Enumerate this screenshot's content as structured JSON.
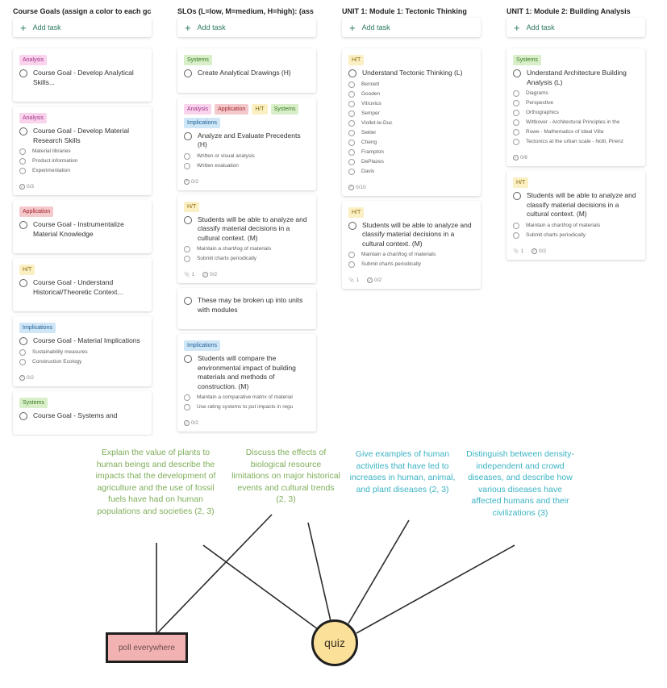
{
  "tag_colors": {
    "Analysis": {
      "bg": "#f9d4ec",
      "fg": "#a2338a"
    },
    "Application": {
      "bg": "#f4c9cc",
      "fg": "#a4262c"
    },
    "H/T": {
      "bg": "#fbefc4",
      "fg": "#8a6d0b"
    },
    "Systems": {
      "bg": "#d8efc9",
      "fg": "#3b7a1f"
    },
    "Implications": {
      "bg": "#cfe6f7",
      "fg": "#1b5e95"
    }
  },
  "board": {
    "add_task_label": "Add task",
    "columns": [
      {
        "title": "Course Goals (assign a color to each gc",
        "cards": [
          {
            "tags": [
              "Analysis"
            ],
            "title": "Course Goal - Develop Analytical Skills...",
            "subtasks": [],
            "footer": {}
          },
          {
            "tags": [
              "Analysis"
            ],
            "title": "Course Goal - Develop Material Research Skills",
            "subtasks": [
              "Material libraries",
              "Product information",
              "Experimentation"
            ],
            "footer": {
              "checklist": "0/3"
            }
          },
          {
            "tags": [
              "Application"
            ],
            "title": "Course Goal - Instrumentalize Material Knowledge",
            "subtasks": [],
            "footer": {}
          },
          {
            "tags": [
              "H/T"
            ],
            "title": "Course Goal - Understand Historical/Theoretic Context...",
            "subtasks": [],
            "footer": {}
          },
          {
            "tags": [
              "Implications"
            ],
            "title": "Course Goal - Material Implications",
            "subtasks": [
              "Sustainability measures",
              "Construction Ecology"
            ],
            "footer": {
              "checklist": "0/2"
            }
          },
          {
            "tags": [
              "Systems"
            ],
            "title": "Course Goal - Systems and",
            "subtasks": [],
            "footer": {}
          }
        ]
      },
      {
        "title": "SLOs (L=low, M=medium, H=high): (ass",
        "cards": [
          {
            "tags": [
              "Systems"
            ],
            "title": "Create Analytical Drawings (H)",
            "subtasks": [],
            "footer": {}
          },
          {
            "tags": [
              "Analysis",
              "Application",
              "H/T",
              "Systems",
              "Implications"
            ],
            "title": "Analyze and Evaluate Precedents (H)",
            "subtasks": [
              "Written or visual analysis",
              "Written evaluation"
            ],
            "footer": {
              "checklist": "0/2"
            }
          },
          {
            "tags": [
              "H/T"
            ],
            "title": "Students will be able to analyze and classify material decisions in a cultural context. (M)",
            "subtasks": [
              "Maintain a chart/log of materials",
              "Submit charts periodically"
            ],
            "footer": {
              "attachments": "1",
              "checklist": "0/2"
            }
          },
          {
            "tags": [],
            "title": "These may be broken up into units with modules",
            "subtasks": [],
            "footer": {}
          },
          {
            "tags": [
              "Implications"
            ],
            "title": "Students will compare the environmental impact of building materials and methods of construction. (M)",
            "subtasks": [
              "Maintain a comparative matrix of material",
              "Use rating systems to put impacts in regu"
            ],
            "footer": {
              "checklist": "0/2"
            }
          }
        ]
      },
      {
        "title": "UNIT 1: Module 1: Tectonic Thinking",
        "cards": [
          {
            "tags": [
              "H/T"
            ],
            "title": "Understand Tectonic Thinking (L)",
            "subtasks": [
              "Bennett",
              "Gooden",
              "Vitruvius",
              "Semper",
              "Viollet-le-Duc",
              "Sekler",
              "Cheng",
              "Frampton",
              "DePlazes",
              "Davis"
            ],
            "footer": {
              "checklist": "0/10"
            }
          },
          {
            "tags": [
              "H/T"
            ],
            "title": "Students will be able to analyze and classify material decisions in a cultural context. (M)",
            "subtasks": [
              "Maintain a chart/log of materials",
              "Submit charts periodically"
            ],
            "footer": {
              "attachments": "1",
              "checklist": "0/2"
            }
          }
        ]
      },
      {
        "title": "UNIT 1: Module 2: Building Analysis",
        "cards": [
          {
            "tags": [
              "Systems"
            ],
            "title": "Understand Architecture Building Analysis (L)",
            "subtasks": [
              "Diagrams",
              "Perspective",
              "Orthographics",
              "Wittkover - Architectural Principles in the",
              "Rowe - Mathematics of Ideal Villa",
              "Tectonics at the urban scale - Nolli, Pirenz"
            ],
            "footer": {
              "checklist": "0/6"
            }
          },
          {
            "tags": [
              "H/T"
            ],
            "title": "Students will be able to analyze and classify material decisions in a cultural context. (M)",
            "subtasks": [
              "Maintain a chart/log of materials",
              "Submit charts periodically"
            ],
            "footer": {
              "attachments": "1",
              "checklist": "0/2"
            }
          }
        ]
      }
    ]
  },
  "diagram": {
    "goals": [
      {
        "text": "Explain the value of plants to human beings and describe the impacts that the development of agriculture and the use of fossil fuels have had on human populations and societies (2, 3)",
        "color": "green"
      },
      {
        "text": "Discuss the effects of biological resource limitations on major historical events and cultural trends (2, 3)",
        "color": "green"
      },
      {
        "text": "Give examples of human activities that have led to increases in human, animal, and plant diseases (2, 3)",
        "color": "teal"
      },
      {
        "text": "Distinguish between density-independent and crowd diseases, and describe how various diseases have affected humans and their civilizations (3)",
        "color": "teal"
      }
    ],
    "assessments": {
      "poll": "poll everywhere",
      "quiz": "quiz"
    },
    "connections": [
      {
        "from": "goal-1",
        "to": "poll"
      },
      {
        "from": "goal-2",
        "to": "poll"
      },
      {
        "from": "goal-1",
        "to": "quiz"
      },
      {
        "from": "goal-2",
        "to": "quiz"
      },
      {
        "from": "goal-3",
        "to": "quiz"
      },
      {
        "from": "goal-4",
        "to": "quiz"
      }
    ]
  }
}
